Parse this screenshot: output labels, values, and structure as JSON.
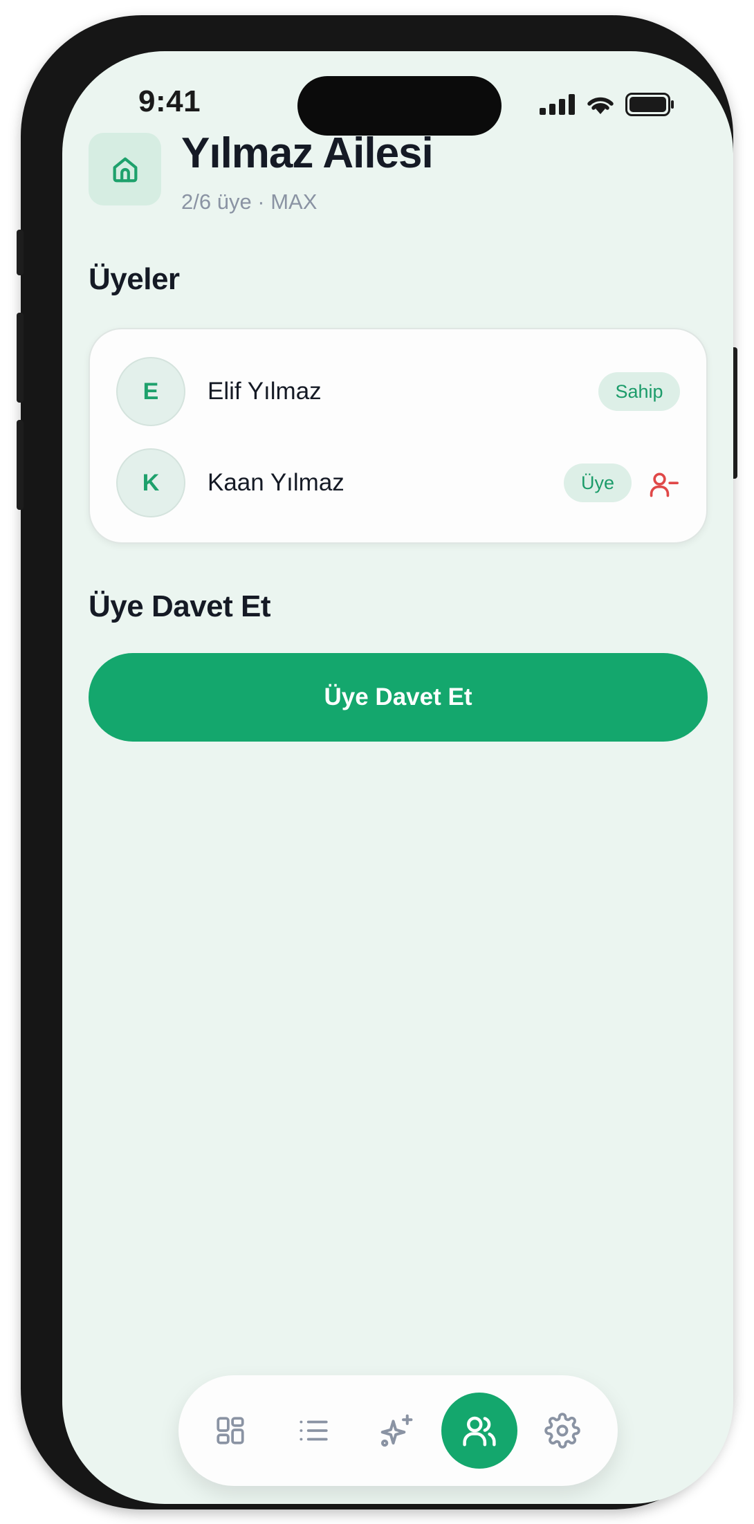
{
  "status_bar": {
    "time": "9:41"
  },
  "header": {
    "icon": "home-icon",
    "title": "Yılmaz Ailesi",
    "subtitle": "2/6 üye · MAX"
  },
  "members_section": {
    "title": "Üyeler",
    "members": [
      {
        "initial": "E",
        "name": "Elif Yılmaz",
        "role": "Sahip",
        "removable": false
      },
      {
        "initial": "K",
        "name": "Kaan Yılmaz",
        "role": "Üye",
        "removable": true,
        "remove_icon": "user-minus-icon"
      }
    ]
  },
  "invite_section": {
    "title": "Üye Davet Et",
    "button_label": "Üye Davet Et"
  },
  "tabbar": {
    "tabs": [
      {
        "icon": "grid-icon",
        "active": false
      },
      {
        "icon": "list-icon",
        "active": false
      },
      {
        "icon": "sparkles-icon",
        "active": false
      },
      {
        "icon": "users-icon",
        "active": true
      },
      {
        "icon": "gear-icon",
        "active": false
      }
    ]
  },
  "colors": {
    "accent": "#14a76d",
    "background": "#ebf5f0",
    "danger": "#e04848",
    "text": "#151a25",
    "muted": "#8a93a3"
  }
}
